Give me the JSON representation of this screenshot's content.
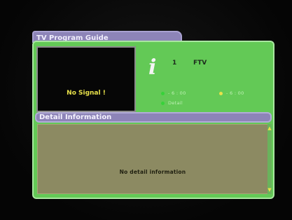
{
  "guide": {
    "title": "TV Program Guide",
    "no_signal": "No Signal !",
    "channel_number": "1",
    "channel_name": "FTV",
    "time_green": "- 6 : 00",
    "time_yellow": "- 6 : 00",
    "detail_label": "Detail",
    "detail_header": "Detail Information",
    "detail_text": "No detail information"
  },
  "colors": {
    "panel": "#63c956",
    "header": "#8d84b8",
    "detail_area": "#8c8a62",
    "green_dot": "#37d23a",
    "yellow_dot": "#e8e14a"
  },
  "icons": {
    "info": "info-icon",
    "scroll_up": "scroll-up-arrow-icon",
    "scroll_down": "scroll-down-arrow-icon"
  }
}
